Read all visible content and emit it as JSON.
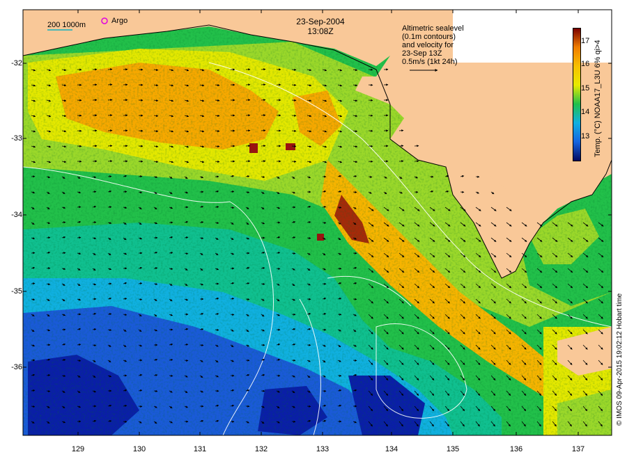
{
  "map": {
    "title_date": "23-Sep-2004",
    "title_time": "13:08Z",
    "scale_label": "200  1000m",
    "argo_label": "Argo",
    "legend_lines": [
      "Altimetric sealevel",
      "(0.1m contours)",
      "and velocity for",
      "23-Sep 13Z",
      "0.5m/s (1kt 24h)"
    ],
    "y_ticks": [
      "-32",
      "-33",
      "-34",
      "-35",
      "-36"
    ],
    "x_ticks": [
      "129",
      "130",
      "131",
      "132",
      "133",
      "134",
      "135",
      "136",
      "137"
    ],
    "colorbar": {
      "label": "Temp. (°C) NOAA17_L3U 6% qi>4",
      "ticks": [
        "17",
        "16",
        "15",
        "14",
        "13"
      ],
      "colors": [
        "#7a0000",
        "#f07d00",
        "#f7c000",
        "#e8ea00",
        "#22c04a",
        "#10b0e0",
        "#1565e0",
        "#050a60"
      ]
    },
    "credit": "© IMOS 09-Apr-2015 19:02:12 Hobart time",
    "land_color": "#f9c898",
    "colors": {
      "warm": "#f7a800",
      "yellow": "#e4e800",
      "lime": "#9bd82a",
      "green": "#22c04a",
      "teal": "#10c090",
      "cyan": "#10b0e0",
      "blue": "#1a5ad8",
      "navy": "#0a1ea8"
    }
  }
}
